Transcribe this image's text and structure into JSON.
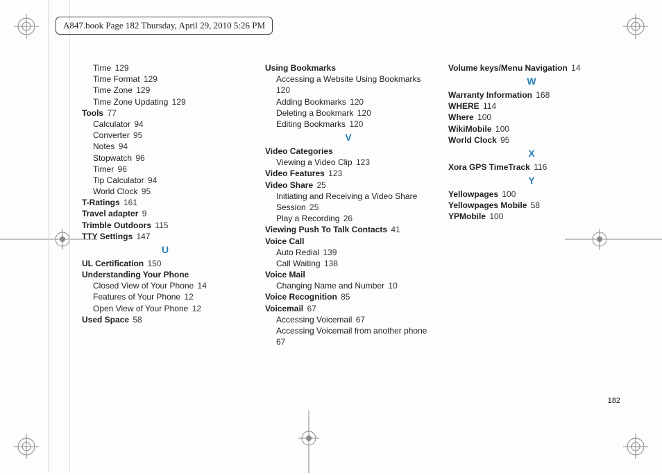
{
  "header": {
    "text": "A847.book  Page 182  Thursday, April 29, 2010  5:26 PM"
  },
  "page_number": "182",
  "letters": {
    "U": "U",
    "V": "V",
    "W": "W",
    "X": "X",
    "Y": "Y"
  },
  "columns": [
    [
      {
        "text": "Time",
        "page": "129",
        "indent": "sub"
      },
      {
        "text": "Time Format",
        "page": "129",
        "indent": "sub"
      },
      {
        "text": "Time Zone",
        "page": "129",
        "indent": "sub"
      },
      {
        "text": "Time Zone Updating",
        "page": "129",
        "indent": "sub"
      },
      {
        "text": "Tools",
        "page": "77",
        "bold": true
      },
      {
        "text": "Calculator",
        "page": "94",
        "indent": "sub"
      },
      {
        "text": "Converter",
        "page": "95",
        "indent": "sub"
      },
      {
        "text": "Notes",
        "page": "94",
        "indent": "sub"
      },
      {
        "text": "Stopwatch",
        "page": "96",
        "indent": "sub"
      },
      {
        "text": "Timer",
        "page": "96",
        "indent": "sub"
      },
      {
        "text": "Tip Calculator",
        "page": "94",
        "indent": "sub"
      },
      {
        "text": "World Clock",
        "page": "95",
        "indent": "sub"
      },
      {
        "text": "T-Ratings",
        "page": "161",
        "bold": true
      },
      {
        "text": "Travel adapter",
        "page": "9",
        "bold": true
      },
      {
        "text": "Trimble Outdoors",
        "page": "115",
        "bold": true
      },
      {
        "text": "TTY Settings",
        "page": "147",
        "bold": true
      },
      {
        "letter": "U"
      },
      {
        "text": "UL Certification",
        "page": "150",
        "bold": true
      },
      {
        "text": "Understanding Your Phone",
        "bold": true
      },
      {
        "text": "Closed View of Your Phone",
        "page": "14",
        "indent": "sub"
      },
      {
        "text": "Features of Your Phone",
        "page": "12",
        "indent": "sub"
      },
      {
        "text": "Open View of Your Phone",
        "page": "12",
        "indent": "sub"
      },
      {
        "text": "Used Space",
        "page": "58",
        "bold": true
      }
    ],
    [
      {
        "text": "Using Bookmarks",
        "bold": true
      },
      {
        "text": "Accessing a Website Using Bookmarks",
        "page": "120",
        "indent": "sub",
        "wrap": true
      },
      {
        "text": "Adding Bookmarks",
        "page": "120",
        "indent": "sub"
      },
      {
        "text": "Deleting a Bookmark",
        "page": "120",
        "indent": "sub"
      },
      {
        "text": "Editing Bookmarks",
        "page": "120",
        "indent": "sub"
      },
      {
        "letter": "V"
      },
      {
        "text": "Video Categories",
        "bold": true
      },
      {
        "text": "Viewing a Video Clip",
        "page": "123",
        "indent": "sub"
      },
      {
        "text": "Video Features",
        "page": "123",
        "bold": true
      },
      {
        "text": "Video Share",
        "page": "25",
        "bold": true
      },
      {
        "text": "Initiating and Receiving a Video Share Session",
        "page": "25",
        "indent": "sub",
        "wrap": true
      },
      {
        "text": "Play a Recording",
        "page": "26",
        "indent": "sub"
      },
      {
        "text": "Viewing Push To Talk Contacts",
        "page": "41",
        "bold": true
      },
      {
        "text": "Voice Call",
        "bold": true
      },
      {
        "text": "Auto Redial",
        "page": "139",
        "indent": "sub"
      },
      {
        "text": "Call Waiting",
        "page": "138",
        "indent": "sub"
      },
      {
        "text": "Voice Mail",
        "bold": true
      },
      {
        "text": "Changing Name and Number",
        "page": "10",
        "indent": "sub"
      },
      {
        "text": "Voice Recognition",
        "page": "85",
        "bold": true
      },
      {
        "text": "Voicemail",
        "page": "67",
        "bold": true
      },
      {
        "text": "Accessing Voicemail",
        "page": "67",
        "indent": "sub"
      },
      {
        "text": "Accessing Voicemail from another phone",
        "page": "67",
        "indent": "sub",
        "wrap": true
      }
    ],
    [
      {
        "text": "Volume keys/Menu Navigation",
        "page": "14",
        "bold": true
      },
      {
        "letter": "W"
      },
      {
        "text": "Warranty Information",
        "page": "168",
        "bold": true
      },
      {
        "text": "WHERE",
        "page": "114",
        "bold": true
      },
      {
        "text": "Where",
        "page": "100",
        "bold": true
      },
      {
        "text": "WikiMobile",
        "page": "100",
        "bold": true
      },
      {
        "text": "World Clock",
        "page": "95",
        "bold": true
      },
      {
        "letter": "X"
      },
      {
        "text": "Xora GPS TimeTrack",
        "page": "116",
        "bold": true
      },
      {
        "letter": "Y"
      },
      {
        "text": "Yellowpages",
        "page": "100",
        "bold": true
      },
      {
        "text": "Yellowpages Mobile",
        "page": "58",
        "bold": true
      },
      {
        "text": "YPMobile",
        "page": "100",
        "bold": true
      }
    ]
  ]
}
